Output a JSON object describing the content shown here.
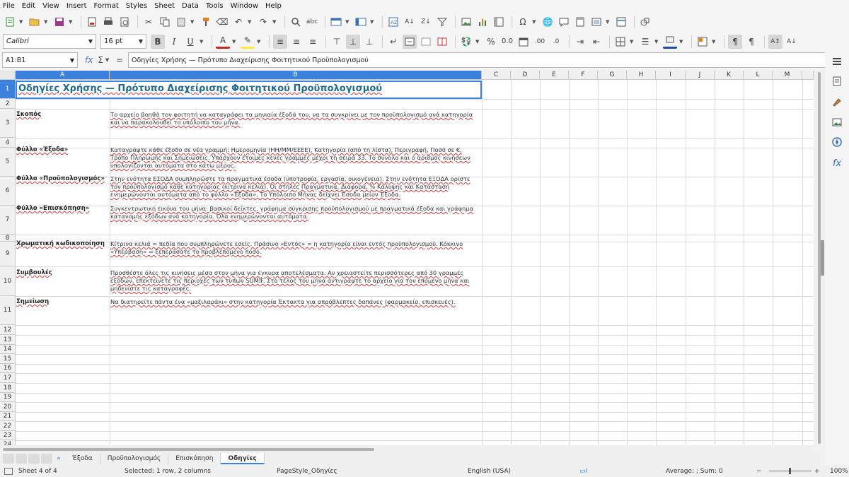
{
  "menu": [
    "File",
    "Edit",
    "View",
    "Insert",
    "Format",
    "Styles",
    "Sheet",
    "Data",
    "Tools",
    "Window",
    "Help"
  ],
  "font": {
    "name": "Calibri",
    "size": "16 pt"
  },
  "formula_bar": {
    "name_box": "A1:B1",
    "content": "Οδηγίες Χρήσης — Πρότυπο Διαχείρισης Φοιτητικού Προϋπολογισμού"
  },
  "columns": [
    "A",
    "B",
    "C",
    "D",
    "E",
    "F",
    "G",
    "H",
    "I",
    "J",
    "K",
    "L",
    "M"
  ],
  "rows": [
    "1",
    "2",
    "3",
    "4",
    "5",
    "6",
    "7",
    "8",
    "9",
    "10",
    "11",
    "12",
    "13",
    "14",
    "15",
    "16",
    "17",
    "18",
    "19",
    "20",
    "21",
    "22",
    "23",
    "24"
  ],
  "cells": {
    "title": "Οδηγίες Χρήσης — Πρότυπο Διαχείρισης Φοιτητικού Προϋπολογισμού",
    "r3a": "Σκοπός",
    "r3b": "Το αρχείο βοηθά τον φοιτητή να καταγράφει τα μηνιαία έξοδά του, να τα συγκρίνει με τον προϋπολογισμό ανά κατηγορία και να παρακολουθεί το υπόλοιπο του μήνα.",
    "r5a": "Φύλλο «Έξοδα»",
    "r5b": "Καταγράψτε κάθε έξοδο σε νέα γραμμή: Ημερομηνία (ΗΗ/ΜΜ/ΕΕΕΕ), Κατηγορία (από τη λίστα), Περιγραφή, Ποσό σε €, Τρόπο Πληρωμής και Σημειώσεις. Υπάρχουν έτοιμες κενές γραμμές μέχρι τη σειρά 33. Το σύνολο και ο αριθμός κινήσεων υπολογίζονται αυτόματα στο κάτω μέρος.",
    "r6a": "Φύλλο «Προϋπολογισμός»",
    "r6b": "Στην ενότητα ΕΣΟΔΑ συμπληρώστε τα πραγματικά έσοδα (υποτροφία, εργασία, οικογένεια). Στην ενότητα ΕΞΟΔΑ ορίστε τον προϋπολογισμό κάθε κατηγορίας (κίτρινα κελιά). Οι στήλες Πραγματικά, Διαφορά, % Κάλυψης και Κατάσταση ενημερώνονται αυτόματα από το φύλλο «Έξοδα». Το Υπόλοιπο Μήνας δείχνει Έσοδα μείον Έξοδα.",
    "r7a": "Φύλλο «Επισκόπηση»",
    "r7b": "Συγκεντρωτική εικόνα του μήνα: βασικοί δείκτες, γράφημα σύγκρισης προϋπολογισμού με πραγματικά έξοδα και γράφημα κατανομής εξόδων ανά κατηγορία. Όλα ενημερώνονται αυτόματα.",
    "r9a": "Χρωματική κωδικοποίηση",
    "r9b": "Κίτρινα κελιά = πεδία που συμπληρώνετε εσείς. Πράσινο «Εντός» = η κατηγορία είναι εντός προϋπολογισμού. Κόκκινο «Υπέρβαση» = ξεπεράσατε το προβλεπόμενο ποσό.",
    "r10a": "Συμβουλές",
    "r10b": "Προσθέστε όλες τις κινήσεις μέσα στον μήνα για έγκυρα αποτελέσματα. Αν χρειαστείτε περισσότερες από 30 γραμμές εξόδων, επεκτείνετε τις περιοχές των τύπων SUMIF. Στο τέλος του μήνα αντιγράψτε το αρχείο για τον επόμενο μήνα και μηδενίστε τις καταγραφές.",
    "r11a": "Σημείωση",
    "r11b": "Να διατηρείτε πάντα ένα «μαξιλαράκι» στην κατηγορία Έκτακτα για απρόβλεπτες δαπάνες (φαρμακείο, επισκευές)."
  },
  "sheet_tabs": [
    "Έξοδα",
    "Προϋπολογισμός",
    "Επισκόπηση",
    "Οδηγίες"
  ],
  "active_tab": "Οδηγίες",
  "status": {
    "sheet": "Sheet 4 of 4",
    "selection": "Selected: 1 row, 2 columns",
    "page_style": "PageStyle_Οδηγίες",
    "language": "English (USA)",
    "summary": "Average: ; Sum: 0",
    "zoom": "100%"
  },
  "colors": {
    "selection": "#3c82dc",
    "title_text": "#1f6b8c"
  }
}
